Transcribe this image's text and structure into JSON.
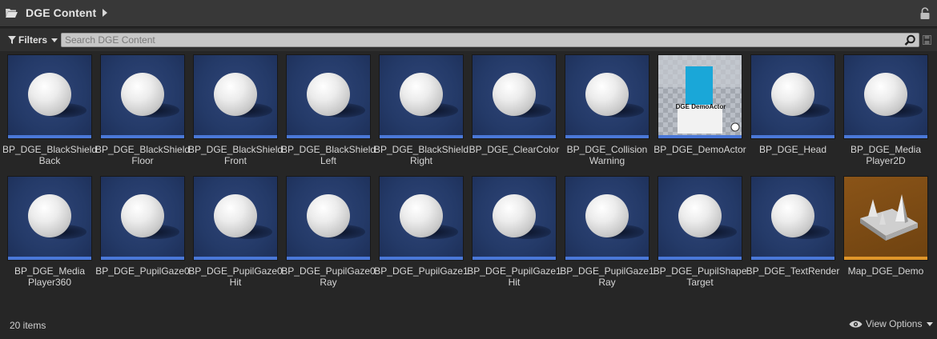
{
  "header": {
    "title": "DGE Content",
    "folder_icon": "folder-open-icon",
    "lock_icon": "lock-icon"
  },
  "toolbar": {
    "filters_label": "Filters",
    "search_placeholder": "Search DGE Content",
    "search_value": ""
  },
  "assets": [
    {
      "label": "BP_DGE_BlackShield\nBack",
      "type": "blueprint"
    },
    {
      "label": "BP_DGE_BlackShield\nFloor",
      "type": "blueprint"
    },
    {
      "label": "BP_DGE_BlackShield\nFront",
      "type": "blueprint"
    },
    {
      "label": "BP_DGE_BlackShield\nLeft",
      "type": "blueprint"
    },
    {
      "label": "BP_DGE_BlackShield\nRight",
      "type": "blueprint"
    },
    {
      "label": "BP_DGE_ClearColor",
      "type": "blueprint"
    },
    {
      "label": "BP_DGE_Collision\nWarning",
      "type": "blueprint"
    },
    {
      "label": "BP_DGE_DemoActor",
      "type": "blueprint-preview",
      "preview_text": "DGE DemoActor"
    },
    {
      "label": "BP_DGE_Head",
      "type": "blueprint"
    },
    {
      "label": "BP_DGE_Media\nPlayer2D",
      "type": "blueprint"
    },
    {
      "label": "BP_DGE_Media\nPlayer360",
      "type": "blueprint"
    },
    {
      "label": "BP_DGE_PupilGaze0",
      "type": "blueprint"
    },
    {
      "label": "BP_DGE_PupilGaze0\nHit",
      "type": "blueprint"
    },
    {
      "label": "BP_DGE_PupilGaze0\nRay",
      "type": "blueprint"
    },
    {
      "label": "BP_DGE_PupilGaze1",
      "type": "blueprint"
    },
    {
      "label": "BP_DGE_PupilGaze1\nHit",
      "type": "blueprint"
    },
    {
      "label": "BP_DGE_PupilGaze1\nRay",
      "type": "blueprint"
    },
    {
      "label": "BP_DGE_PupilShape\nTarget",
      "type": "blueprint"
    },
    {
      "label": "BP_DGE_TextRender",
      "type": "blueprint"
    },
    {
      "label": "Map_DGE_Demo",
      "type": "map"
    }
  ],
  "footer": {
    "item_count": "20 items",
    "view_options_label": "View Options"
  },
  "colors": {
    "blueprint_bar": "#4a78d8",
    "map_bar": "#e0962a",
    "background": "#262626"
  }
}
